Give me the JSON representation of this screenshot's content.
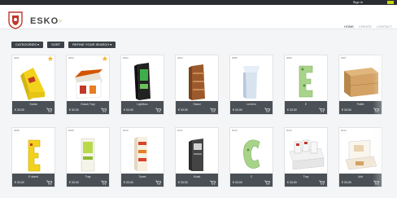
{
  "topbar": {
    "signin": "Sign in"
  },
  "header": {
    "brand_main": "ESKO",
    "brand_dot": "◦",
    "nav": [
      "HOME",
      "CREATE",
      "CONTACT"
    ]
  },
  "filters": [
    "CATEGORIES ▾",
    "SORT",
    "REFINE YOUR SEARCH ▾"
  ],
  "cards_row1": [
    {
      "id": "0001",
      "name": "Santa",
      "price": "€ 33.00",
      "starred": true
    },
    {
      "id": "0002",
      "name": "Snack Tray",
      "price": "€ 32.00",
      "starred": true
    },
    {
      "id": "0003",
      "name": "Lightbox",
      "price": "€ 33.00",
      "starred": false
    },
    {
      "id": "0004",
      "name": "Stand",
      "price": "€ 33.00",
      "starred": false
    },
    {
      "id": "0005",
      "name": "Lectern",
      "price": "€ 33.00",
      "starred": false
    },
    {
      "id": "0006",
      "name": "E",
      "price": "€ 33.00",
      "starred": false
    },
    {
      "id": "0007",
      "name": "Pallet",
      "price": "€ 33.00",
      "starred": false
    }
  ],
  "cards_row2": [
    {
      "id": "0008",
      "name": "E stand",
      "price": "€ 33.00",
      "starred": false
    },
    {
      "id": "0009",
      "name": "Tray",
      "price": "€ 33.00",
      "starred": false
    },
    {
      "id": "0010",
      "name": "Tower",
      "price": "€ 33.00",
      "starred": false
    },
    {
      "id": "0011",
      "name": "Kiosk",
      "price": "€ 33.00",
      "starred": false
    },
    {
      "id": "0012",
      "name": "C",
      "price": "€ 33.00",
      "starred": false
    },
    {
      "id": "0013",
      "name": "Tray",
      "price": "€ 33.00",
      "starred": false
    },
    {
      "id": "0014",
      "name": "Unit",
      "price": "€ 33.00",
      "starred": false
    }
  ],
  "star_glyph": "★"
}
